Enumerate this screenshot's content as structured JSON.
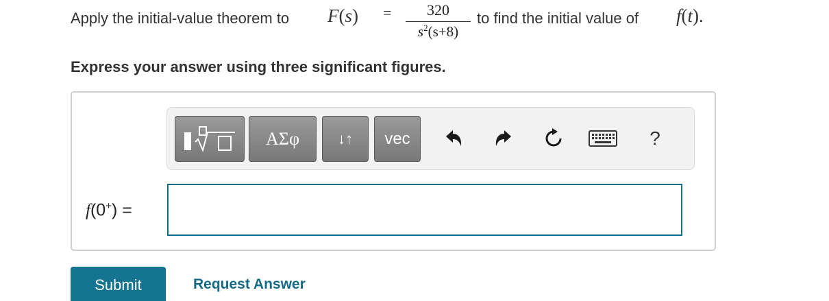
{
  "question": {
    "prefix": "Apply the initial-value theorem to ",
    "func_name": "F",
    "func_paren_open": "(",
    "func_var": "s",
    "func_paren_close": ")",
    "equals": "=",
    "numerator": "320",
    "denominator_base": "s",
    "denominator_exp": "2",
    "denominator_rest": "(s+8)",
    "suffix": " to find the initial value of ",
    "target_func": "f",
    "target_paren_open": "(",
    "target_var": "t",
    "target_paren_close": ").",
    "instruction": "Express your answer using three significant figures."
  },
  "toolbar": {
    "templates_icon": "fraction-sqrt-template-icon",
    "greek_label": "ΑΣφ",
    "arrows_label": "↓↑",
    "vec_label": "vec",
    "undo_icon": "undo-icon",
    "redo_icon": "redo-icon",
    "reset_icon": "reset-icon",
    "keyboard_icon": "keyboard-icon",
    "help_label": "?"
  },
  "answer": {
    "label_func": "f",
    "label_open": "(0",
    "label_sup": "+",
    "label_close": ") =",
    "value": ""
  },
  "actions": {
    "submit_label": "Submit",
    "request_label": "Request Answer"
  },
  "colors": {
    "accent": "#15748f",
    "input_border": "#0d6f8a",
    "toolbar_button": "#888888"
  }
}
